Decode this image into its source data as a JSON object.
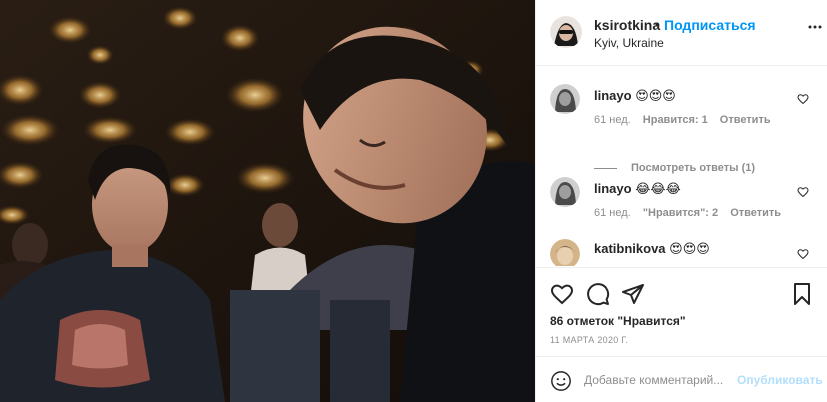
{
  "post": {
    "username": "ksirotkina",
    "separator": "•",
    "follow_label": "Подписаться",
    "location": "Kyiv, Ukraine"
  },
  "comments": [
    {
      "username": "linayo",
      "text": "😍😍😍",
      "age": "61 нед.",
      "likes": "Нравится: 1",
      "reply": "Ответить"
    },
    {
      "username": "linayo",
      "text": "😂😂😂",
      "age": "61 нед.",
      "likes": "\"Нравится\": 2",
      "reply": "Ответить"
    },
    {
      "username": "katibnikova",
      "text": "😍😍😍"
    }
  ],
  "view_replies_label": "Посмотреть ответы (1)",
  "likes_summary": "86 отметок \"Нравится\"",
  "date": "11 МАРТА 2020 Г.",
  "add_comment": {
    "placeholder": "Добавьте комментарий...",
    "post_label": "Опубликовать"
  },
  "icons": {
    "more": "more-horizontal-icon",
    "heart": "heart-icon",
    "comment": "comment-icon",
    "share": "share-icon",
    "save": "bookmark-icon",
    "emoji": "emoji-icon"
  },
  "colors": {
    "accent": "#0095f6",
    "muted": "#8e8e8e",
    "text": "#262626",
    "post_button_disabled": "#b2dffc"
  }
}
